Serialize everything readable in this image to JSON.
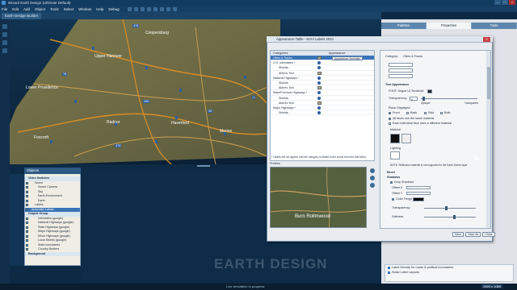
{
  "app": {
    "title": "Wizard Earth Design (Ultimate Default)",
    "menu": [
      "File",
      "Edit",
      "Add",
      "Object",
      "Tools",
      "Select",
      "Window",
      "Help",
      "Debug"
    ],
    "doc_tab": "Earth Design Builder"
  },
  "map": {
    "labels": [
      "Coopersburg",
      "Upper Hanover",
      "Lower Providence",
      "Radnor",
      "Haverford",
      "Merion",
      "Foxcroft",
      "Burn"
    ],
    "route_badges": [
      "476",
      "76",
      "202",
      "476",
      "30",
      "1"
    ]
  },
  "objects_panel": {
    "title": "Objects",
    "items": [
      {
        "label": "Video Switches",
        "kind": "grp"
      },
      {
        "label": "Scene",
        "kind": "lvl2"
      },
      {
        "label": "Scene Camera",
        "kind": "lvl3"
      },
      {
        "label": "Sky",
        "kind": "lvl3"
      },
      {
        "label": "Earth Environment",
        "kind": "lvl3"
      },
      {
        "label": "Earth",
        "kind": "lvl3"
      },
      {
        "label": "Labels",
        "kind": "lvl2"
      },
      {
        "label": "Automatic Labels",
        "kind": "sel"
      },
      {
        "label": "Draped Group",
        "kind": "grp"
      },
      {
        "label": "Interstates (google)",
        "kind": "lvl3"
      },
      {
        "label": "National Highways (google)",
        "kind": "lvl3"
      },
      {
        "label": "State Highways (google)",
        "kind": "lvl3"
      },
      {
        "label": "Major Highways (google)",
        "kind": "lvl3"
      },
      {
        "label": "Minor Highways (google)",
        "kind": "lvl3"
      },
      {
        "label": "Local Streets (google)",
        "kind": "lvl3"
      },
      {
        "label": "State boundaries",
        "kind": "lvl3"
      },
      {
        "label": "Country Borders",
        "kind": "lvl3"
      },
      {
        "label": "Background",
        "kind": "grp"
      }
    ]
  },
  "watermark": "EARTH DESIGN",
  "status": {
    "message": "Live simulation in progress",
    "resolution": "1920 x 1080"
  },
  "right_panel": {
    "tabs": [
      "Palettes",
      "Properties",
      "Tools"
    ],
    "active_tab": "Properties",
    "footer_items": [
      "Label Density for roads & political boundaries.",
      "Static Label Layouts"
    ]
  },
  "dialog": {
    "title": "Appearance Table - NAVI Labels 2024",
    "close": "X",
    "categories_header": "Categories",
    "appearance_header": "Appearance",
    "categories": [
      {
        "label": "Cities & Towns",
        "kind": "sel",
        "swatch": "btn",
        "btn": "Appearance Overrides"
      },
      {
        "label": "U.S. Interstates *",
        "kind": "main",
        "swatch": "dot"
      },
      {
        "label": "Shields",
        "kind": "sub",
        "swatch": "dot"
      },
      {
        "label": "Abbrev Text",
        "kind": "sub",
        "swatch": "sq"
      },
      {
        "label": "National Highways *",
        "kind": "main",
        "swatch": "dot"
      },
      {
        "label": "Shields",
        "kind": "sub",
        "swatch": "dot"
      },
      {
        "label": "Abbrev Text",
        "kind": "sub",
        "swatch": "sq"
      },
      {
        "label": "State/Province Highways *",
        "kind": "main",
        "swatch": "dot"
      },
      {
        "label": "Shields",
        "kind": "sub",
        "swatch": "dot"
      },
      {
        "label": "Abbrev Text",
        "kind": "sub",
        "swatch": "sq"
      },
      {
        "label": "Major Highways *",
        "kind": "main",
        "swatch": "dot"
      },
      {
        "label": "Shields",
        "kind": "sub",
        "swatch": "dot"
      }
    ],
    "categories_note": "* Labels will not appear until the category is added to the scene from the Add Menu",
    "preview_label": "Preview",
    "preview_text": "Burn Rollmwood",
    "properties": {
      "category_label": "Category:",
      "category_value": "Cities & Towns",
      "text_appearance": "Text Appearance",
      "font": "FONT: Segoe UI Semibold",
      "transparency_label": "Transparency",
      "transparency_value": "0",
      "transparency_min": "Opaque",
      "transparency_max": "Transparent",
      "placement_label": "Place Displayed",
      "placement_opts": [
        "Front",
        "Back",
        "Side",
        "Both"
      ],
      "face_opts": [
        "All faces use the same material",
        "Each individual face uses a different material"
      ],
      "material_label": "Material",
      "lighting_label": "Lighting",
      "note": "NOTE: Reflection material is not supported in the Earth Scene layer",
      "bevel": "Bevel",
      "shadows": "Shadows",
      "drop_shadows": "Drop Shadows",
      "offset_x": "Offset X",
      "offset_y": "Offset Y",
      "color_fringe": "Color Fringe",
      "transparency2": "Transparency",
      "softness": "Softness"
    },
    "buttons": [
      "Save",
      "Save As",
      "Close"
    ]
  }
}
